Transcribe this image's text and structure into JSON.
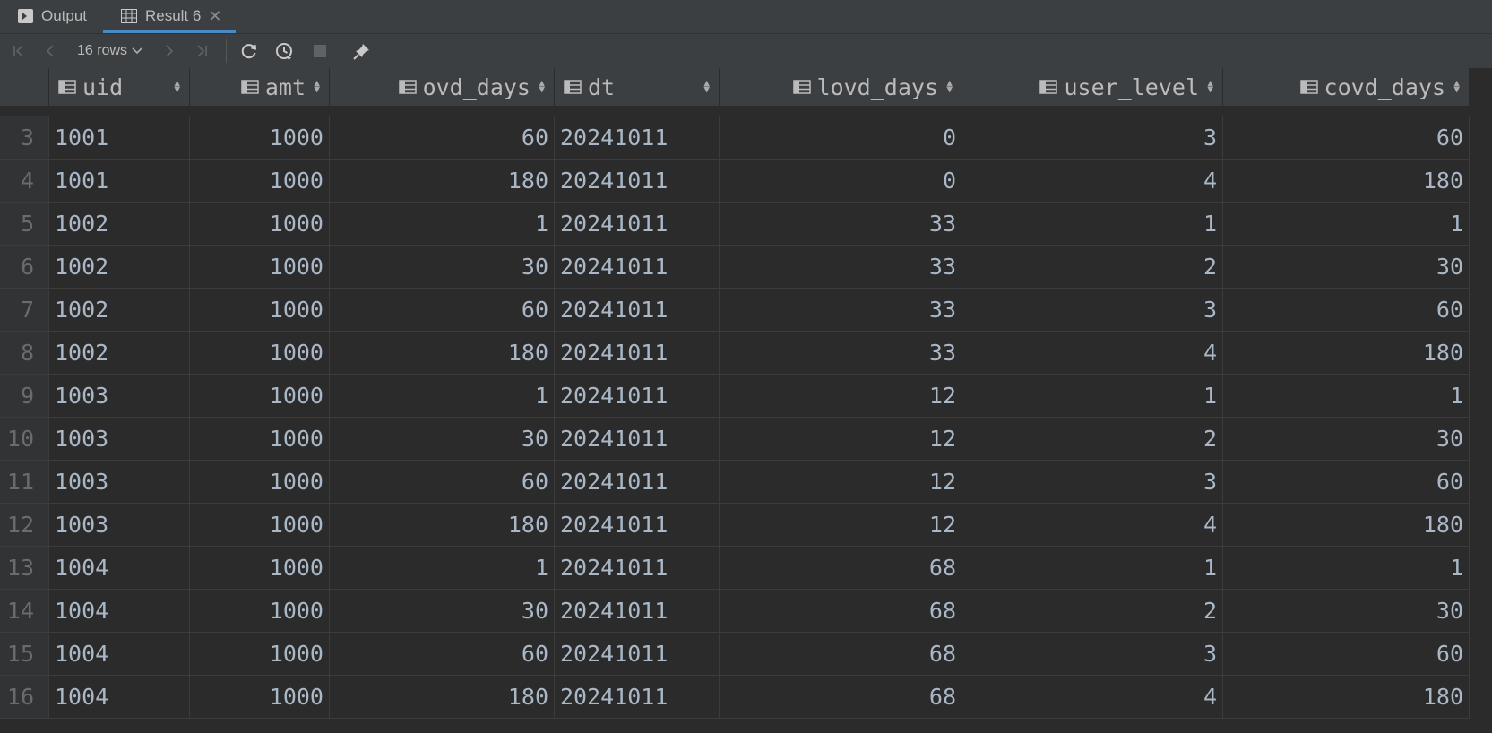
{
  "tabs": {
    "output_label": "Output",
    "result_label": "Result 6",
    "close_glyph": "✕"
  },
  "toolbar": {
    "rows_label": "16 rows"
  },
  "columns": [
    "uid",
    "amt",
    "ovd_days",
    "dt",
    "lovd_days",
    "user_level",
    "covd_days"
  ],
  "rows": [
    {
      "n": "3",
      "uid": "1001",
      "amt": "1000",
      "ovd_days": "60",
      "dt": "20241011",
      "lovd_days": "0",
      "user_level": "3",
      "covd_days": "60"
    },
    {
      "n": "4",
      "uid": "1001",
      "amt": "1000",
      "ovd_days": "180",
      "dt": "20241011",
      "lovd_days": "0",
      "user_level": "4",
      "covd_days": "180"
    },
    {
      "n": "5",
      "uid": "1002",
      "amt": "1000",
      "ovd_days": "1",
      "dt": "20241011",
      "lovd_days": "33",
      "user_level": "1",
      "covd_days": "1"
    },
    {
      "n": "6",
      "uid": "1002",
      "amt": "1000",
      "ovd_days": "30",
      "dt": "20241011",
      "lovd_days": "33",
      "user_level": "2",
      "covd_days": "30"
    },
    {
      "n": "7",
      "uid": "1002",
      "amt": "1000",
      "ovd_days": "60",
      "dt": "20241011",
      "lovd_days": "33",
      "user_level": "3",
      "covd_days": "60"
    },
    {
      "n": "8",
      "uid": "1002",
      "amt": "1000",
      "ovd_days": "180",
      "dt": "20241011",
      "lovd_days": "33",
      "user_level": "4",
      "covd_days": "180"
    },
    {
      "n": "9",
      "uid": "1003",
      "amt": "1000",
      "ovd_days": "1",
      "dt": "20241011",
      "lovd_days": "12",
      "user_level": "1",
      "covd_days": "1"
    },
    {
      "n": "10",
      "uid": "1003",
      "amt": "1000",
      "ovd_days": "30",
      "dt": "20241011",
      "lovd_days": "12",
      "user_level": "2",
      "covd_days": "30"
    },
    {
      "n": "11",
      "uid": "1003",
      "amt": "1000",
      "ovd_days": "60",
      "dt": "20241011",
      "lovd_days": "12",
      "user_level": "3",
      "covd_days": "60"
    },
    {
      "n": "12",
      "uid": "1003",
      "amt": "1000",
      "ovd_days": "180",
      "dt": "20241011",
      "lovd_days": "12",
      "user_level": "4",
      "covd_days": "180"
    },
    {
      "n": "13",
      "uid": "1004",
      "amt": "1000",
      "ovd_days": "1",
      "dt": "20241011",
      "lovd_days": "68",
      "user_level": "1",
      "covd_days": "1"
    },
    {
      "n": "14",
      "uid": "1004",
      "amt": "1000",
      "ovd_days": "30",
      "dt": "20241011",
      "lovd_days": "68",
      "user_level": "2",
      "covd_days": "30"
    },
    {
      "n": "15",
      "uid": "1004",
      "amt": "1000",
      "ovd_days": "60",
      "dt": "20241011",
      "lovd_days": "68",
      "user_level": "3",
      "covd_days": "60"
    },
    {
      "n": "16",
      "uid": "1004",
      "amt": "1000",
      "ovd_days": "180",
      "dt": "20241011",
      "lovd_days": "68",
      "user_level": "4",
      "covd_days": "180"
    }
  ]
}
